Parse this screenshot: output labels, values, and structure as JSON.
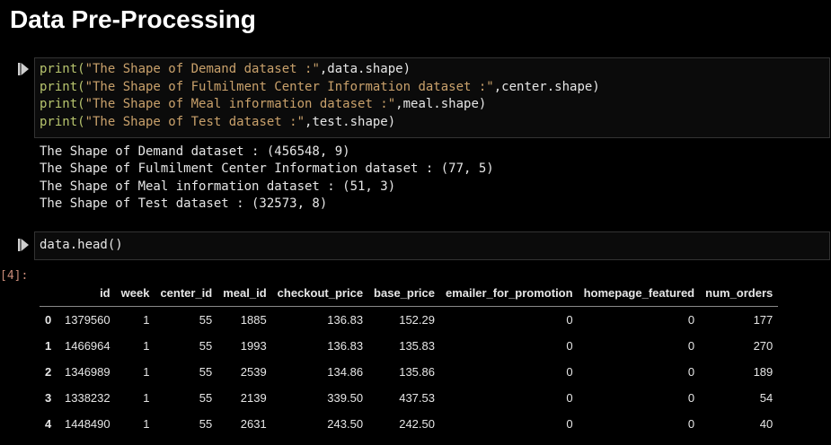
{
  "heading": "Data Pre-Processing",
  "cell1": {
    "lines": [
      {
        "fn": "print",
        "str": "\"The Shape of Demand dataset :\"",
        "rest": ",data.shape)"
      },
      {
        "fn": "print",
        "str": "\"The Shape of Fulmilment Center Information dataset :\"",
        "rest": ",center.shape)"
      },
      {
        "fn": "print",
        "str": "\"The Shape of Meal information dataset :\"",
        "rest": ",meal.shape)"
      },
      {
        "fn": "print",
        "str": "\"The Shape of Test dataset :\"",
        "rest": ",test.shape)"
      }
    ],
    "output": [
      "The Shape of Demand dataset : (456548, 9)",
      "The Shape of Fulmilment Center Information dataset : (77, 5)",
      "The Shape of Meal information dataset : (51, 3)",
      "The Shape of Test dataset : (32573, 8)"
    ]
  },
  "cell2": {
    "code": "data.head()",
    "prompt": "[4]:",
    "table": {
      "columns": [
        "",
        "id",
        "week",
        "center_id",
        "meal_id",
        "checkout_price",
        "base_price",
        "emailer_for_promotion",
        "homepage_featured",
        "num_orders"
      ],
      "rows": [
        [
          "0",
          "1379560",
          "1",
          "55",
          "1885",
          "136.83",
          "152.29",
          "0",
          "0",
          "177"
        ],
        [
          "1",
          "1466964",
          "1",
          "55",
          "1993",
          "136.83",
          "135.83",
          "0",
          "0",
          "270"
        ],
        [
          "2",
          "1346989",
          "1",
          "55",
          "2539",
          "134.86",
          "135.86",
          "0",
          "0",
          "189"
        ],
        [
          "3",
          "1338232",
          "1",
          "55",
          "2139",
          "339.50",
          "437.53",
          "0",
          "0",
          "54"
        ],
        [
          "4",
          "1448490",
          "1",
          "55",
          "2631",
          "243.50",
          "242.50",
          "0",
          "0",
          "40"
        ]
      ]
    }
  }
}
